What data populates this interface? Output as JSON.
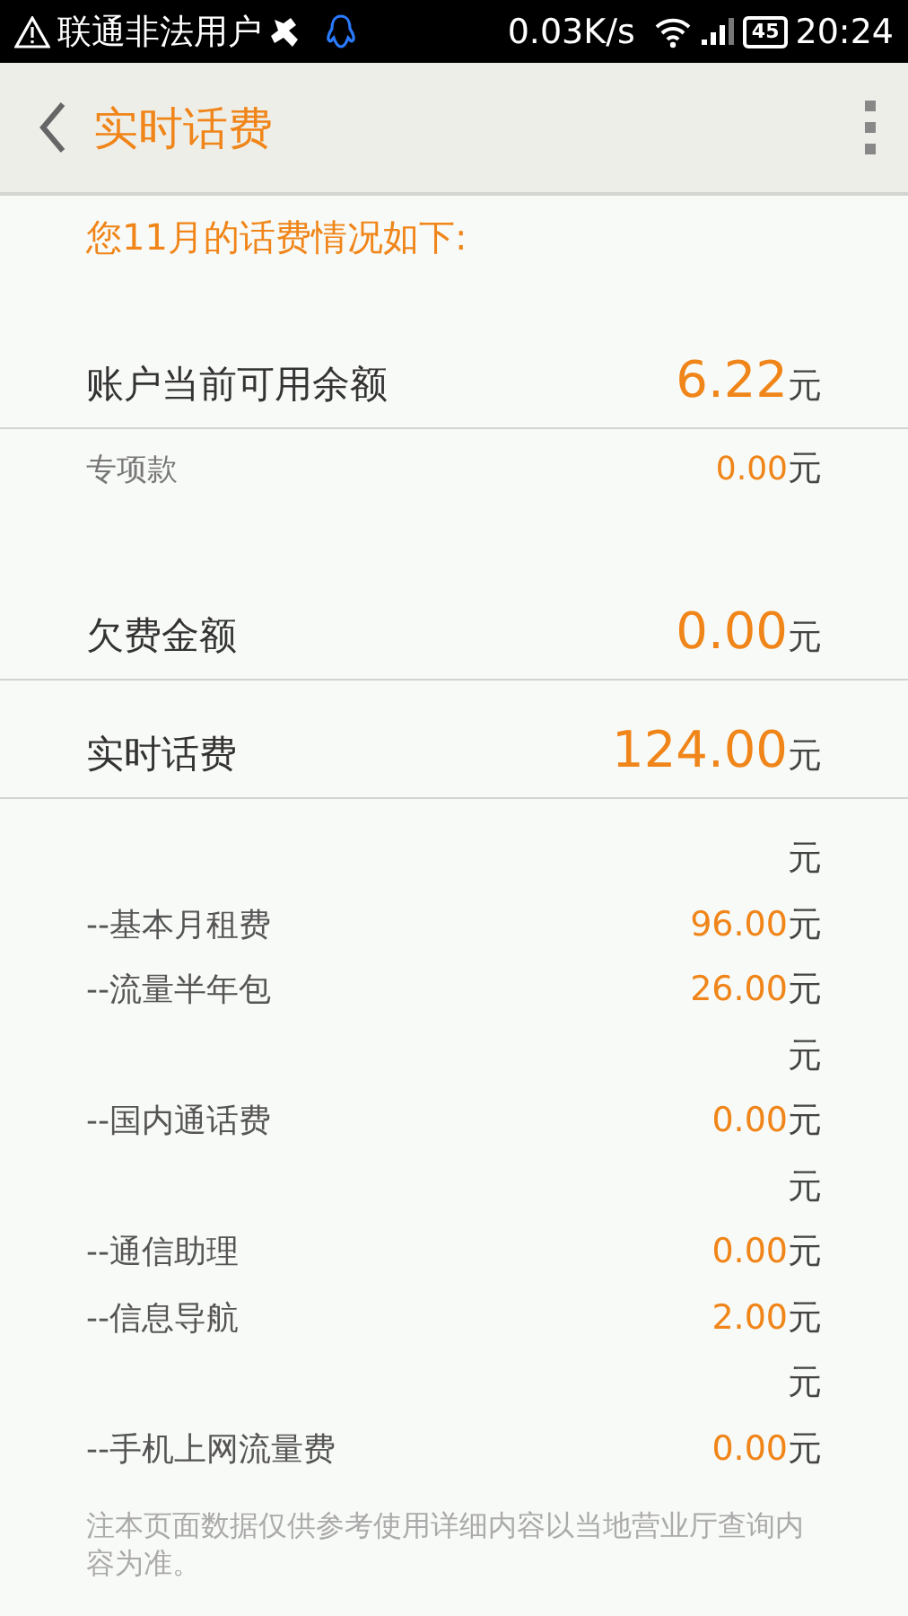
{
  "status_bar": {
    "carrier": "联通非法用户",
    "speed": "0.03K/s",
    "battery": "45",
    "time": "20:24"
  },
  "header": {
    "title": "实时话费"
  },
  "intro": "您11月的话费情况如下:",
  "summary": [
    {
      "kind": "major",
      "label": "账户当前可用余额",
      "amount": "6.22",
      "unit": "元"
    },
    {
      "kind": "minor",
      "label": "专项款",
      "amount": "0.00",
      "unit": "元"
    },
    {
      "kind": "major",
      "label": "欠费金额",
      "amount": "0.00",
      "unit": "元"
    },
    {
      "kind": "major",
      "label": "实时话费",
      "amount": "124.00",
      "unit": "元"
    }
  ],
  "details": [
    {
      "kind": "unit",
      "unit": "元"
    },
    {
      "kind": "item",
      "label": "--基本月租费",
      "amount": "96.00",
      "unit": "元"
    },
    {
      "kind": "item",
      "label": "--流量半年包",
      "amount": "26.00",
      "unit": "元"
    },
    {
      "kind": "unit",
      "unit": "元"
    },
    {
      "kind": "item",
      "label": "--国内通话费",
      "amount": "0.00",
      "unit": "元"
    },
    {
      "kind": "unit",
      "unit": "元"
    },
    {
      "kind": "item",
      "label": "--通信助理",
      "amount": "0.00",
      "unit": "元"
    },
    {
      "kind": "item",
      "label": "--信息导航",
      "amount": "2.00",
      "unit": "元"
    },
    {
      "kind": "unit",
      "unit": "元"
    },
    {
      "kind": "item",
      "label": "--手机上网流量费",
      "amount": "0.00",
      "unit": "元"
    }
  ],
  "note": "注本页面数据仅供参考使用详细内容以当地营业厅查询内容为准。"
}
